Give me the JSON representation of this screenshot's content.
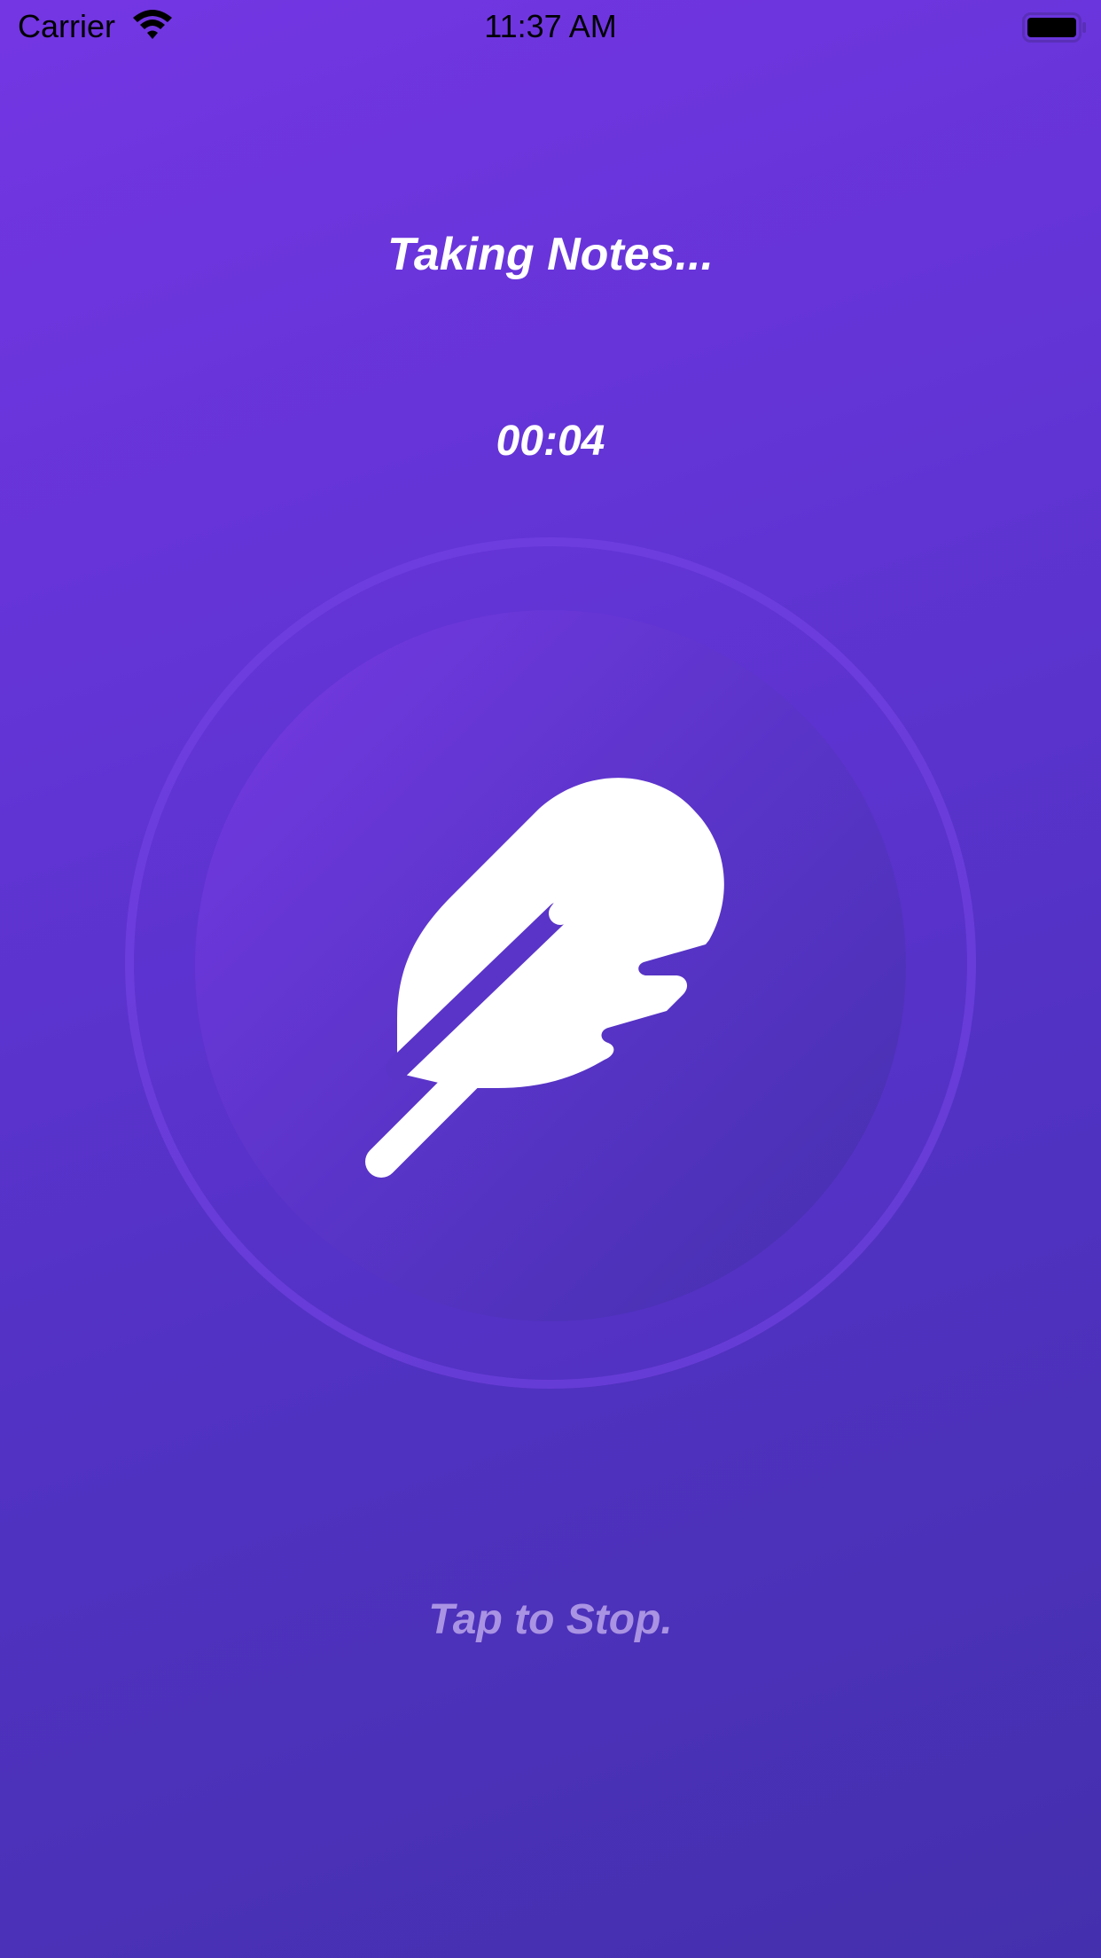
{
  "status_bar": {
    "carrier": "Carrier",
    "time": "11:37 AM",
    "wifi_icon": "wifi-icon",
    "battery_icon": "battery-icon"
  },
  "screen": {
    "title": "Taking Notes...",
    "timer": "00:04",
    "record_icon": "feather-icon",
    "hint": "Tap to Stop."
  },
  "colors": {
    "background_top": "#7436e3",
    "background_bottom": "#4430ad",
    "text": "#ffffff",
    "hint_text": "#c8b4f0"
  }
}
